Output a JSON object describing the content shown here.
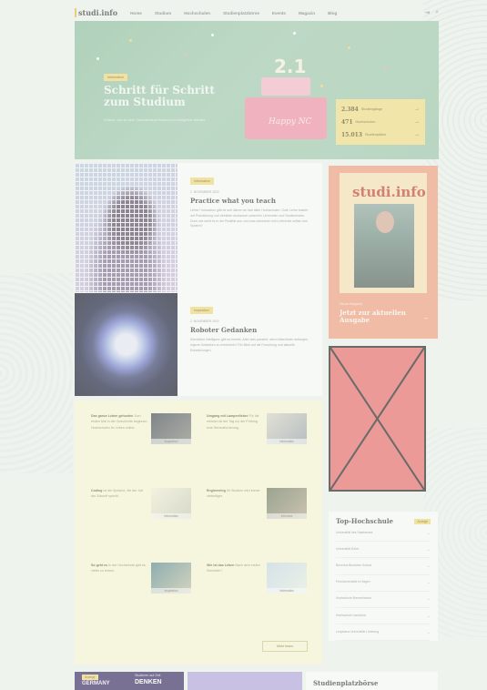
{
  "header": {
    "logo": "studi.info",
    "nav": [
      "Home",
      "Studium",
      "Hochschulen",
      "Studienplatzbörse",
      "Events",
      "Magazin",
      "Blog"
    ],
    "login_icon": "login-icon",
    "search_icon": "search-icon"
  },
  "hero": {
    "badge": "Information",
    "title": "Schritt für Schritt zum Studium",
    "text": "Erfahre, wie du dein Traumstudium findest und erfolgreich startest.",
    "cake_year": "2.1",
    "cake_label": "Happy NC",
    "stats": [
      {
        "number": "2.384",
        "label": "Studiengänge"
      },
      {
        "number": "471",
        "label": "Hochschulen"
      },
      {
        "number": "15.013",
        "label": "Studienplätze"
      }
    ]
  },
  "articles": [
    {
      "badge": "Information",
      "date": "2. NOVEMBER 2022",
      "title": "Practice what you teach",
      "body": "Lehre? Innovation gibt es seit Jahren an fast allen Hochschulen. Gute Lehre basiert auf Praxisbezug und direktem Austausch zwischen Lehrenden und Studierenden. Doch wie sieht es in der Realität aus, und was wünschen sich Lehrende selbst vom System?"
    },
    {
      "badge": "Inspiration",
      "date": "2. NOVEMBER 2022",
      "title": "Roboter Gedanken",
      "body": "Künstliche Intelligenz gibt es bereits. Aber was passiert, wenn Maschinen anfangen, eigene Gedanken zu entwickeln? Ein Blick auf die Forschung und aktuelle Entwicklungen."
    }
  ],
  "magazine": {
    "logo": "studi.info",
    "label": "Neues Magazin",
    "cta": "Jetzt zur aktuellen Ausgabe"
  },
  "news": [
    {
      "title": "Das ganze Leben gehosten",
      "text": "Zum ersten Mal in der Geschichte beginnen Hochschulen ihr Leben online.",
      "tag": "Inspiration"
    },
    {
      "title": "Umgang mit Lampenfieber",
      "text": "Für die meisten ist der Tag vor der Prüfung eine Herausforderung.",
      "tag": "Information"
    },
    {
      "title": "Coding",
      "text": "Ist die Sprache, die der Job der Zukunft spricht.",
      "tag": "Information"
    },
    {
      "title": "Engineering",
      "text": "Ihr Studium wird immer vielseitiger.",
      "tag": "Interview"
    },
    {
      "title": "So geht es",
      "text": "In der Hochschule gibt es vieles zu lernen.",
      "tag": "Inspiration"
    },
    {
      "title": "Wie ist das Leben",
      "text": "Nach dem ersten Semester?",
      "tag": "Information"
    }
  ],
  "news_more": "Mehr lesen",
  "ranking": {
    "title": "Top-Hochschule",
    "badge": "Anzeige",
    "items": [
      "Universität des Saarlandes",
      "Universität Erfurt",
      "Bucerius Business School",
      "FernUniversität in Hagen",
      "Hochschule Bremerhaven",
      "Hochschule Landshut",
      "Leuphana Universität Lüneburg"
    ]
  },
  "bottom": {
    "tag": "Anzeige",
    "left_title": "GERMANY",
    "mid_small": "Studieren auf Zeit",
    "mid_big": "DENKEN",
    "right_title": "Studienplatzbörse"
  },
  "colors": {
    "accent_yellow": "#f3d97a",
    "hero_green": "#9cc7aa",
    "magazine_orange": "#f29f7e",
    "ad_red": "#ea6a6a"
  }
}
